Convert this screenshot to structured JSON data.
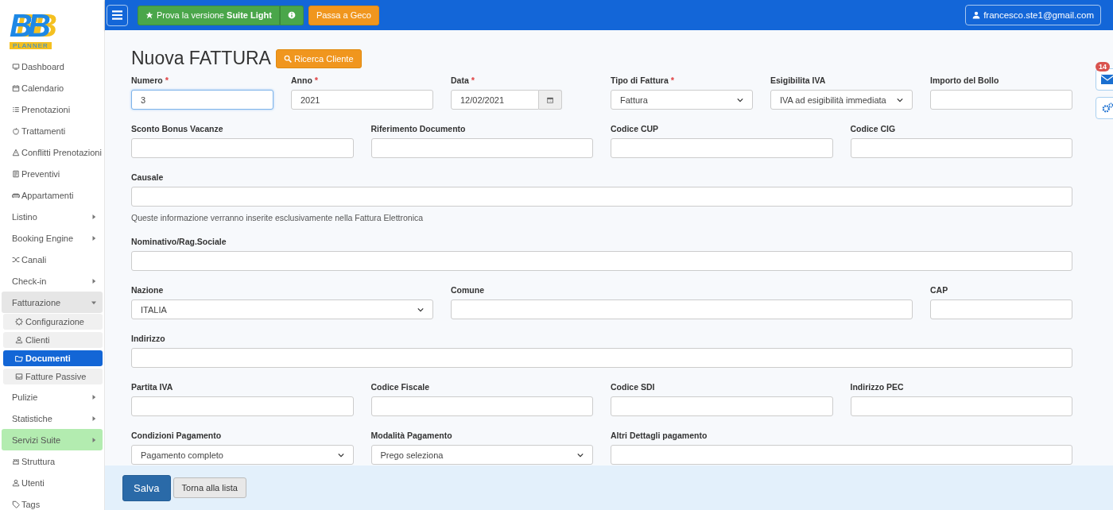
{
  "logo": {
    "mark": "BB",
    "tagline": "PLANNER"
  },
  "sidebar": {
    "items": [
      {
        "label": "Dashboard"
      },
      {
        "label": "Calendario"
      },
      {
        "label": "Prenotazioni"
      },
      {
        "label": "Trattamenti"
      },
      {
        "label": "Conflitti Prenotazioni"
      },
      {
        "label": "Preventivi"
      },
      {
        "label": "Appartamenti"
      },
      {
        "label": "Listino",
        "expanded": false,
        "highlight": false
      },
      {
        "label": "Booking Engine",
        "expanded": false,
        "highlight": false
      },
      {
        "label": "Canali"
      },
      {
        "label": "Check-in",
        "expanded": false,
        "highlight": false
      },
      {
        "label": "Fatturazione",
        "expanded": true,
        "highlight": false,
        "children": [
          {
            "label": "Configurazione",
            "selected": false
          },
          {
            "label": "Clienti",
            "selected": false
          },
          {
            "label": "Documenti",
            "selected": true
          },
          {
            "label": "Fatture Passive",
            "selected": false
          }
        ]
      },
      {
        "label": "Pulizie",
        "expanded": false,
        "highlight": false
      },
      {
        "label": "Statistiche",
        "expanded": false,
        "highlight": false
      },
      {
        "label": "Servizi Suite",
        "expanded": false,
        "highlight": true
      },
      {
        "label": "Struttura"
      },
      {
        "label": "Utenti"
      },
      {
        "label": "Tags"
      }
    ]
  },
  "topbar": {
    "trial_button": "Prova la versione **Suite Light**",
    "geco_button": "Passa a Geco",
    "user": "francesco.ste1@gmail.com"
  },
  "page": {
    "title": "Nuova FATTURA",
    "search_button": "Ricerca Cliente"
  },
  "notifications": {
    "count": "14"
  },
  "form": {
    "rows": [
      {
        "fields": [
          {
            "label": "Numero",
            "mark": "*",
            "kind": "text",
            "value": "3",
            "focused": true
          },
          {
            "label": "Anno",
            "mark": "*",
            "kind": "text",
            "value": "2021"
          },
          {
            "label": "Data",
            "mark": "*",
            "kind": "date",
            "value": "12/02/2021"
          },
          {
            "label": "Tipo di Fattura",
            "mark": "*",
            "kind": "select",
            "value": "Fattura"
          },
          {
            "label": "Esigibilita IVA",
            "kind": "select",
            "value": "IVA ad esigibilità  immediata"
          },
          {
            "label": "Importo del Bollo",
            "kind": "text"
          }
        ]
      },
      {
        "fields": [
          {
            "label": "Sconto Bonus Vacanze",
            "kind": "text"
          },
          {
            "label": "Riferimento Documento",
            "kind": "text"
          },
          {
            "label": "Codice CUP",
            "kind": "text"
          },
          {
            "label": "Codice CIG",
            "kind": "text"
          }
        ]
      },
      {
        "fields": [
          {
            "label": "Causale",
            "kind": "text"
          }
        ],
        "help": "Queste informazione verranno inserite esclusivamente nella Fattura Elettronica"
      },
      {
        "fields": [
          {
            "label": "Nominativo/Rag.Sociale",
            "kind": "text"
          }
        ]
      },
      {
        "fields": [
          {
            "label": "Nazione",
            "kind": "select",
            "value": "ITALIA"
          },
          {
            "label": "Comune",
            "kind": "text"
          },
          {
            "label": "CAP",
            "kind": "text"
          }
        ]
      },
      {
        "fields": [
          {
            "label": "Indirizzo",
            "kind": "text"
          }
        ]
      },
      {
        "fields": [
          {
            "label": "Partita IVA",
            "kind": "text"
          },
          {
            "label": "Codice Fiscale",
            "kind": "text"
          },
          {
            "label": "Codice SDI",
            "kind": "text"
          },
          {
            "label": "Indirizzo PEC",
            "kind": "text"
          }
        ]
      },
      {
        "fields": [
          {
            "label": "Condizioni Pagamento",
            "kind": "select",
            "value": "Pagamento completo"
          },
          {
            "label": "Modalità Pagamento",
            "kind": "select",
            "value": "Prego seleziona"
          },
          {
            "label": "Altri Dettagli pagamento",
            "kind": "text"
          }
        ]
      }
    ]
  },
  "footer": {
    "save_button": "Salva",
    "back_button": "Torna alla lista"
  }
}
